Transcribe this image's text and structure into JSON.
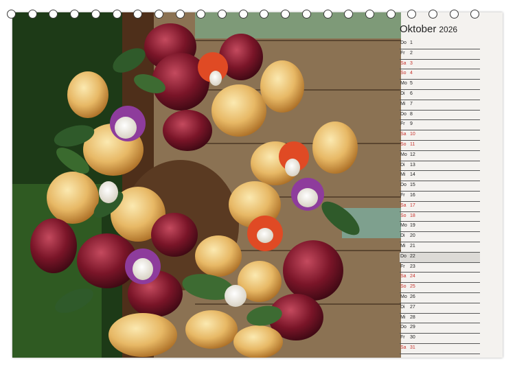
{
  "calendar": {
    "month": "Oktober",
    "year": "2026",
    "weekend_color": "#c8322c",
    "ring_count": 23,
    "days": [
      {
        "name": "Do",
        "num": "1"
      },
      {
        "name": "Fr",
        "num": "2"
      },
      {
        "name": "Sa",
        "num": "3",
        "weekend": true
      },
      {
        "name": "So",
        "num": "4",
        "weekend": true
      },
      {
        "name": "Mo",
        "num": "5"
      },
      {
        "name": "Di",
        "num": "6"
      },
      {
        "name": "Mi",
        "num": "7"
      },
      {
        "name": "Do",
        "num": "8"
      },
      {
        "name": "Fr",
        "num": "9"
      },
      {
        "name": "Sa",
        "num": "10",
        "weekend": true
      },
      {
        "name": "So",
        "num": "11",
        "weekend": true
      },
      {
        "name": "Mo",
        "num": "12"
      },
      {
        "name": "Di",
        "num": "13"
      },
      {
        "name": "Mi",
        "num": "14"
      },
      {
        "name": "Do",
        "num": "15"
      },
      {
        "name": "Fr",
        "num": "16"
      },
      {
        "name": "Sa",
        "num": "17",
        "weekend": true
      },
      {
        "name": "So",
        "num": "18",
        "weekend": true
      },
      {
        "name": "Mo",
        "num": "19"
      },
      {
        "name": "Di",
        "num": "20"
      },
      {
        "name": "Mi",
        "num": "21"
      },
      {
        "name": "Do",
        "num": "22",
        "highlight": true
      },
      {
        "name": "Fr",
        "num": "23"
      },
      {
        "name": "Sa",
        "num": "24",
        "weekend": true
      },
      {
        "name": "So",
        "num": "25",
        "weekend": true
      },
      {
        "name": "Mo",
        "num": "26"
      },
      {
        "name": "Di",
        "num": "27"
      },
      {
        "name": "Mi",
        "num": "28"
      },
      {
        "name": "Do",
        "num": "29"
      },
      {
        "name": "Fr",
        "num": "30"
      },
      {
        "name": "Sa",
        "num": "31",
        "weekend": true
      }
    ]
  }
}
